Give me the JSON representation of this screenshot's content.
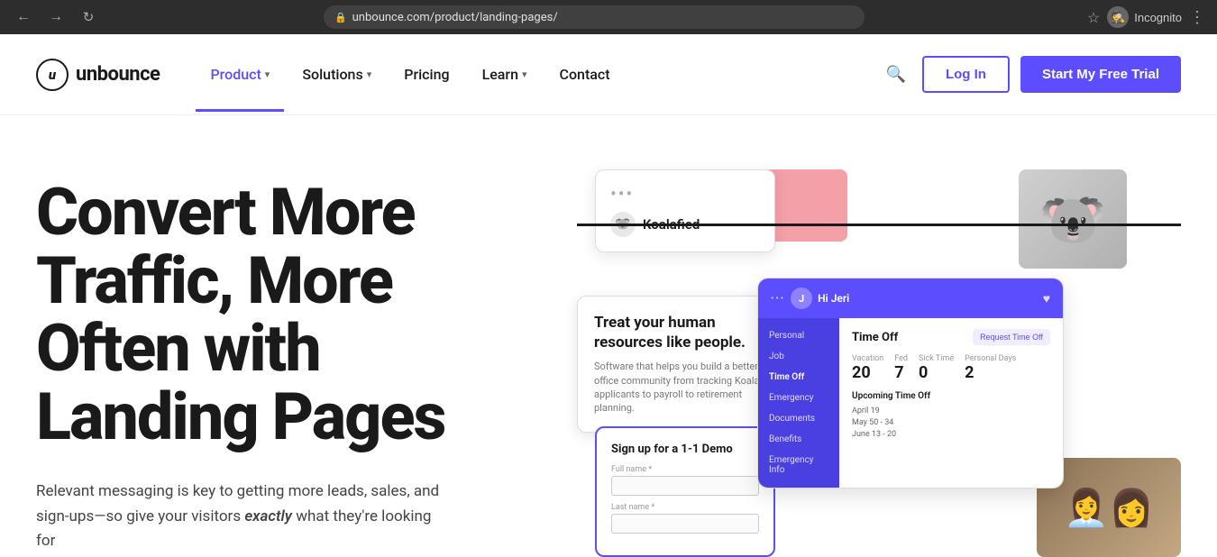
{
  "browser": {
    "url": "unbounce.com/product/landing-pages/",
    "tab_label": "Incognito"
  },
  "header": {
    "logo_symbol": "u",
    "logo_name": "unbounce",
    "nav": [
      {
        "label": "Product",
        "has_dropdown": true,
        "active": true
      },
      {
        "label": "Solutions",
        "has_dropdown": true,
        "active": false
      },
      {
        "label": "Pricing",
        "has_dropdown": false,
        "active": false
      },
      {
        "label": "Learn",
        "has_dropdown": true,
        "active": false
      },
      {
        "label": "Contact",
        "has_dropdown": false,
        "active": false
      }
    ],
    "login_label": "Log In",
    "trial_label": "Start My Free Trial",
    "search_icon": "🔍"
  },
  "hero": {
    "headline": "Convert More Traffic, More Often with Landing Pages",
    "subtext_before": "Relevant messaging is key to getting more leads, sales, and sign-ups—so give your visitors ",
    "subtext_em": "exactly",
    "subtext_after": " what they're looking for"
  },
  "ui_cards": {
    "koalafied": {
      "brand": "Koalafied",
      "dots": "•••"
    },
    "hr": {
      "title": "Treat your human resources like people.",
      "subtitle": "Software that helps you build a better office community from tracking Koalafied applicants to payroll to retirement planning."
    },
    "timeoff": {
      "header_name": "Hi Jeri",
      "title": "Time Off",
      "request_btn": "Request Time Off",
      "sidebar_items": [
        "Personal",
        "Job",
        "Time Off",
        "Emergency",
        "Documents",
        "Benefits",
        "Emergency Info"
      ],
      "stats": [
        {
          "label": "Vacation",
          "value": "20"
        },
        {
          "label": "Fed",
          "value": "7"
        },
        {
          "label": "Sick Time",
          "value": "0"
        },
        {
          "label": "Personal Days",
          "value": "2"
        }
      ],
      "upcoming_title": "Upcoming Time Off",
      "upcoming": [
        "April 19",
        "May 50 - 34",
        "June 13 - 20"
      ]
    },
    "demo": {
      "title": "Sign up for a 1-1 Demo",
      "fields": [
        {
          "label": "Full name *"
        },
        {
          "label": "Last name *"
        }
      ]
    }
  },
  "colors": {
    "accent": "#5c4dff",
    "pink": "#f4a0a8",
    "purple_light": "rgba(180,160,255,0.25)",
    "dark": "#1a1a1a"
  }
}
